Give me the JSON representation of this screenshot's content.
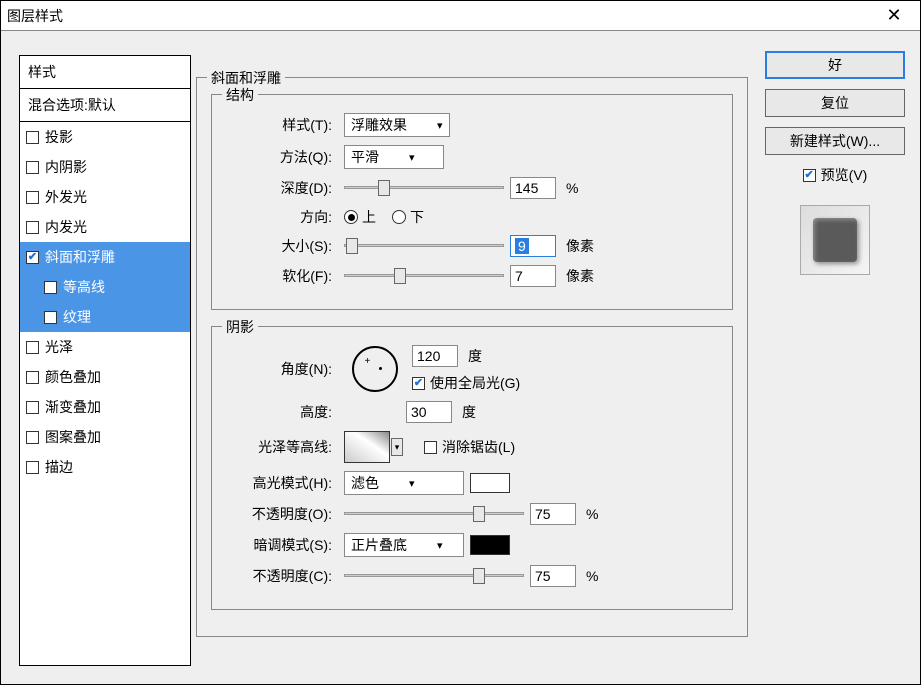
{
  "window": {
    "title": "图层样式",
    "close": "✕"
  },
  "styles": {
    "header": "样式",
    "subheader": "混合选项:默认",
    "items": [
      {
        "label": "投影",
        "checked": false
      },
      {
        "label": "内阴影",
        "checked": false
      },
      {
        "label": "外发光",
        "checked": false
      },
      {
        "label": "内发光",
        "checked": false
      },
      {
        "label": "斜面和浮雕",
        "checked": true,
        "selected": true
      },
      {
        "label": "等高线",
        "checked": false,
        "child": true,
        "selected": true
      },
      {
        "label": "纹理",
        "checked": false,
        "child": true,
        "selected": true
      },
      {
        "label": "光泽",
        "checked": false
      },
      {
        "label": "颜色叠加",
        "checked": false
      },
      {
        "label": "渐变叠加",
        "checked": false
      },
      {
        "label": "图案叠加",
        "checked": false
      },
      {
        "label": "描边",
        "checked": false
      }
    ]
  },
  "section": {
    "title": "斜面和浮雕",
    "structure": {
      "legend": "结构",
      "style_label": "样式(T):",
      "style_value": "浮雕效果",
      "technique_label": "方法(Q):",
      "technique_value": "平滑",
      "depth_label": "深度(D):",
      "depth_value": "145",
      "depth_unit": "%",
      "direction_label": "方向:",
      "up": "上",
      "down": "下",
      "size_label": "大小(S):",
      "size_value": "9",
      "size_unit": "像素",
      "soften_label": "软化(F):",
      "soften_value": "7",
      "soften_unit": "像素"
    },
    "shading": {
      "legend": "阴影",
      "angle_label": "角度(N):",
      "angle_value": "120",
      "angle_unit": "度",
      "global_light": "使用全局光(G)",
      "altitude_label": "高度:",
      "altitude_value": "30",
      "altitude_unit": "度",
      "gloss_label": "光泽等高线:",
      "antialias": "消除锯齿(L)",
      "highlight_mode_label": "高光模式(H):",
      "highlight_mode_value": "滤色",
      "highlight_opacity_label": "不透明度(O):",
      "highlight_opacity_value": "75",
      "opacity_unit": "%",
      "shadow_mode_label": "暗调模式(S):",
      "shadow_mode_value": "正片叠底",
      "shadow_opacity_label": "不透明度(C):",
      "shadow_opacity_value": "75",
      "highlight_color": "#ffffff",
      "shadow_color": "#000000"
    }
  },
  "right": {
    "ok": "好",
    "cancel": "复位",
    "new_style": "新建样式(W)...",
    "preview": "预览(V)"
  }
}
